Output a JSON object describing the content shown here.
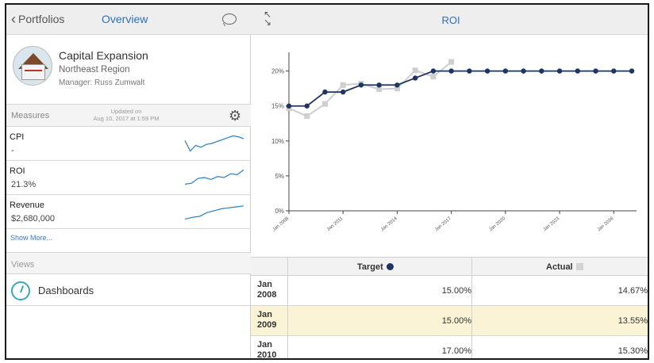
{
  "nav": {
    "back_label": "Portfolios",
    "overview_label": "Overview",
    "chat_icon": "chat-bubble-icon"
  },
  "project": {
    "name": "Capital Expansion",
    "region": "Northeast Region",
    "manager": "Manager: Russ Zumwalt"
  },
  "measures": {
    "header": "Measures",
    "updated_line1": "Updated on",
    "updated_line2": "Aug 10, 2017 at 1:59 PM",
    "items": [
      {
        "label": "CPI",
        "value": "-",
        "spark": [
          0.35,
          0.9,
          0.6,
          0.7,
          0.55,
          0.5,
          0.4,
          0.3,
          0.2,
          0.1,
          0.15,
          0.25
        ]
      },
      {
        "label": "ROI",
        "value": "21.3%",
        "spark": [
          0.85,
          0.8,
          0.55,
          0.5,
          0.6,
          0.45,
          0.5,
          0.3,
          0.35,
          0.1
        ]
      },
      {
        "label": "Revenue",
        "value": "$2,680,000",
        "spark": [
          0.9,
          0.8,
          0.75,
          0.55,
          0.45,
          0.35,
          0.3,
          0.25,
          0.2
        ]
      }
    ],
    "show_more": "Show More..."
  },
  "views": {
    "header": "Views",
    "dashboards_label": "Dashboards"
  },
  "right": {
    "title": "ROI",
    "expand_icon": "expand-icon"
  },
  "chart_data": {
    "type": "line",
    "title": "ROI",
    "y_ticks": [
      "0%",
      "5%",
      "10%",
      "15%",
      "20%"
    ],
    "ylim": [
      0,
      22
    ],
    "x_ticks": [
      "Jan 2008",
      "Jan 2011",
      "Jan 2014",
      "Jan 2017",
      "Jan 2020",
      "Jan 2023",
      "Jan 2026"
    ],
    "x": [
      2008,
      2009,
      2010,
      2011,
      2012,
      2013,
      2014,
      2015,
      2016,
      2017,
      2018,
      2019,
      2020,
      2021,
      2022,
      2023,
      2024,
      2025,
      2026,
      2027
    ],
    "series": [
      {
        "name": "Target",
        "color": "#1f3462",
        "values": [
          15,
          15,
          17,
          17,
          18,
          18,
          18,
          19,
          20,
          20,
          20,
          20,
          20,
          20,
          20,
          20,
          20,
          20,
          20,
          20
        ]
      },
      {
        "name": "Actual",
        "color": "#cfcfcf",
        "values": [
          14.67,
          13.55,
          15.3,
          18,
          18.2,
          17.4,
          17.5,
          20.1,
          19.2,
          21.3,
          null,
          null,
          null,
          null,
          null,
          null,
          null,
          null,
          null,
          null
        ]
      }
    ],
    "grid": false,
    "legend": "table-header"
  },
  "table": {
    "header_target": "Target",
    "header_actual": "Actual",
    "rows": [
      {
        "date1": "Jan",
        "date2": "2008",
        "target": "15.00%",
        "actual": "14.67%"
      },
      {
        "date1": "Jan",
        "date2": "2009",
        "target": "15.00%",
        "actual": "13.55%"
      },
      {
        "date1": "Jan",
        "date2": "2010",
        "target": "17.00%",
        "actual": "15.30%"
      }
    ]
  }
}
